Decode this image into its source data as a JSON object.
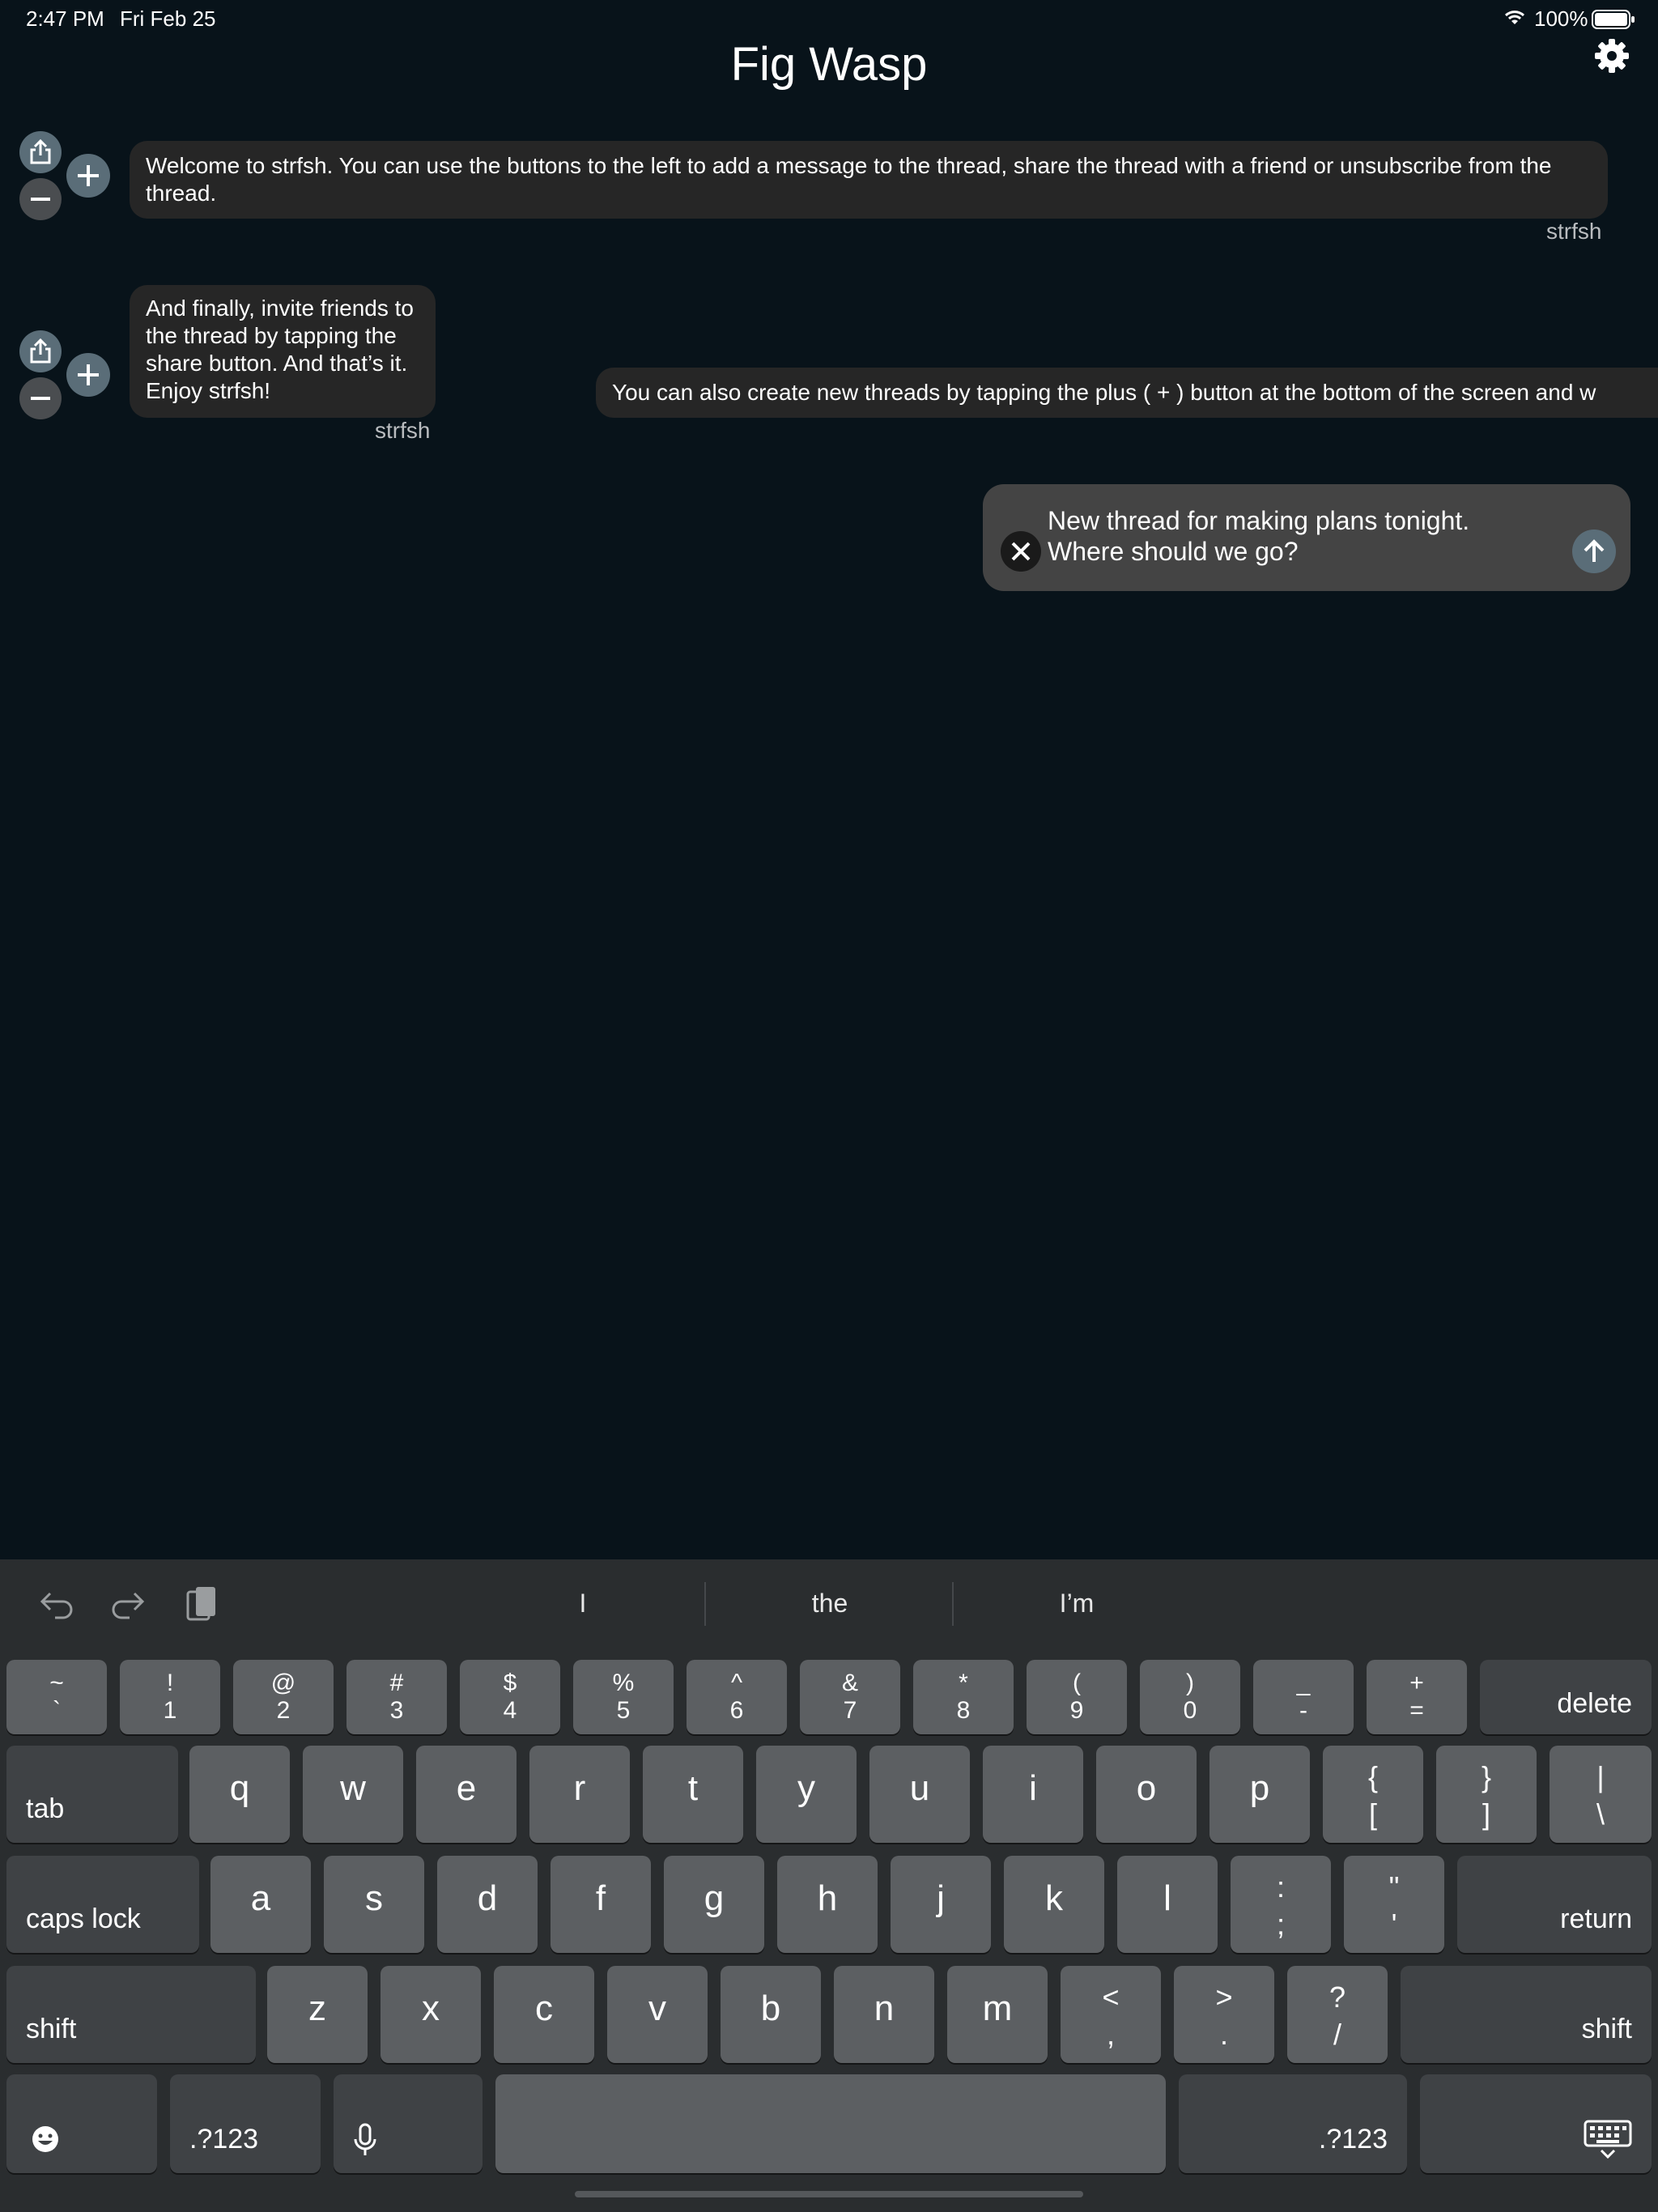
{
  "status_bar": {
    "time": "2:47 PM",
    "date": "Fri Feb 25",
    "battery": "100%"
  },
  "header": {
    "title": "Fig Wasp",
    "settings_icon": "gear-icon"
  },
  "messages": [
    {
      "text": "Welcome to strfsh. You can use the buttons to the left to add a message to the thread, share the thread with a friend or unsubscribe from the thread.",
      "author": "strfsh"
    },
    {
      "text": "And finally, invite friends to the thread by tapping the share button. And that’s it. Enjoy strfsh!",
      "author": "strfsh"
    },
    {
      "text": "You can also create new threads by tapping the plus ( + ) button at the bottom of the screen and w"
    }
  ],
  "compose": {
    "text": "New thread for making plans tonight. Where should we go?"
  },
  "keyboard": {
    "suggestions": [
      "I",
      "the",
      "I’m"
    ],
    "row1": [
      {
        "top": "~",
        "bottom": "`"
      },
      {
        "top": "!",
        "bottom": "1"
      },
      {
        "top": "@",
        "bottom": "2"
      },
      {
        "top": "#",
        "bottom": "3"
      },
      {
        "top": "$",
        "bottom": "4"
      },
      {
        "top": "%",
        "bottom": "5"
      },
      {
        "top": "^",
        "bottom": "6"
      },
      {
        "top": "&",
        "bottom": "7"
      },
      {
        "top": "*",
        "bottom": "8"
      },
      {
        "top": "(",
        "bottom": "9"
      },
      {
        "top": ")",
        "bottom": "0"
      },
      {
        "top": "_",
        "bottom": "-"
      },
      {
        "top": "+",
        "bottom": "="
      }
    ],
    "delete": "delete",
    "tab": "tab",
    "row2": [
      "q",
      "w",
      "e",
      "r",
      "t",
      "y",
      "u",
      "i",
      "o",
      "p"
    ],
    "row2_sym": [
      {
        "top": "{",
        "bottom": "["
      },
      {
        "top": "}",
        "bottom": "]"
      },
      {
        "top": "|",
        "bottom": "\\"
      }
    ],
    "caps_lock": "caps lock",
    "row3": [
      "a",
      "s",
      "d",
      "f",
      "g",
      "h",
      "j",
      "k",
      "l"
    ],
    "row3_sym": [
      {
        "top": ":",
        "bottom": ";"
      },
      {
        "top": "\"",
        "bottom": "'"
      }
    ],
    "return": "return",
    "shift": "shift",
    "row4": [
      "z",
      "x",
      "c",
      "v",
      "b",
      "n",
      "m"
    ],
    "row4_sym": [
      {
        "top": "<",
        "bottom": ","
      },
      {
        "top": ">",
        "bottom": "."
      },
      {
        "top": "?",
        "bottom": "/"
      }
    ],
    "numbers_label": ".?123"
  }
}
